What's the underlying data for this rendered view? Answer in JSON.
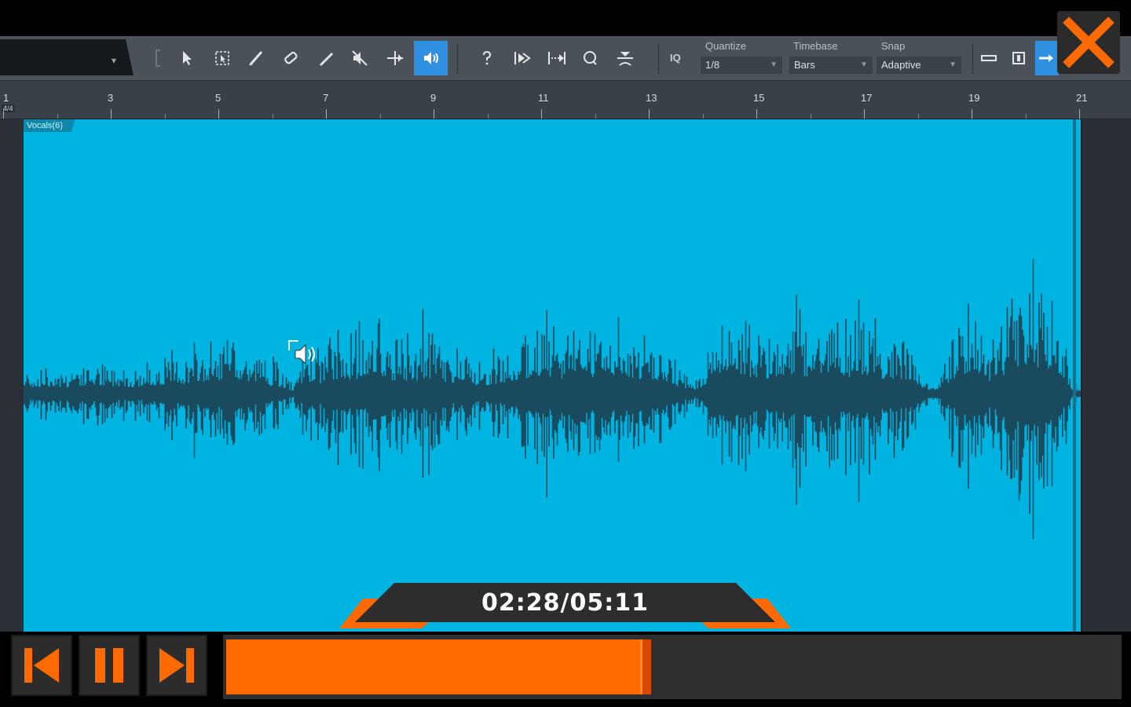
{
  "toolbar": {
    "tools": [
      {
        "name": "arrow-tool-icon",
        "active": false
      },
      {
        "name": "range-tool-icon",
        "active": false
      },
      {
        "name": "split-tool-icon",
        "active": false
      },
      {
        "name": "eraser-tool-icon",
        "active": false
      },
      {
        "name": "paint-tool-icon",
        "active": false
      },
      {
        "name": "mute-tool-icon",
        "active": false
      },
      {
        "name": "bend-tool-icon",
        "active": false
      },
      {
        "name": "listen-tool-icon",
        "active": true
      }
    ],
    "quantize": {
      "label": "Quantize",
      "value": "1/8"
    },
    "timebase": {
      "label": "Timebase",
      "value": "Bars"
    },
    "snap": {
      "label": "Snap",
      "value": "Adaptive"
    },
    "iq_label": "IQ"
  },
  "ruler": {
    "time_signature": "4/4",
    "bars": [
      "1",
      "3",
      "5",
      "7",
      "9",
      "11",
      "13",
      "15",
      "17",
      "19",
      "21"
    ]
  },
  "clip": {
    "label": "Vocals(6)",
    "color": "#00b4e1",
    "waveform_color": "#1a4a5e"
  },
  "player": {
    "time_display": "02:28/05:11",
    "progress_fraction": 0.476,
    "accent": "#ff6a00"
  }
}
